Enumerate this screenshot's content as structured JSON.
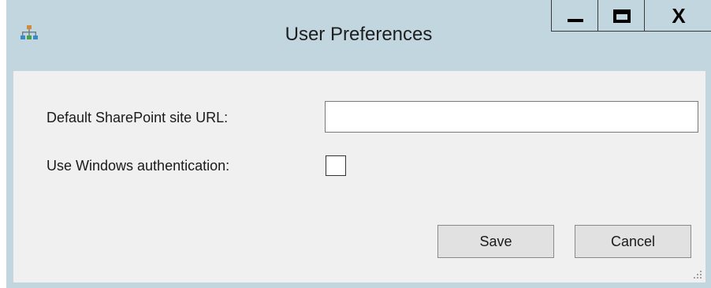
{
  "window": {
    "title": "User Preferences",
    "icon": "org-chart-icon",
    "controls": {
      "minimize": "minimize",
      "maximize": "maximize",
      "close_glyph": "X"
    }
  },
  "form": {
    "url_label": "Default SharePoint site URL:",
    "url_value": "",
    "auth_label": "Use Windows authentication:",
    "auth_checked": false
  },
  "buttons": {
    "save_label": "Save",
    "cancel_label": "Cancel"
  },
  "colors": {
    "titlebar": "#c2d6e0",
    "content_bg": "#f0f0f0",
    "button_bg": "#e1e1e1"
  }
}
